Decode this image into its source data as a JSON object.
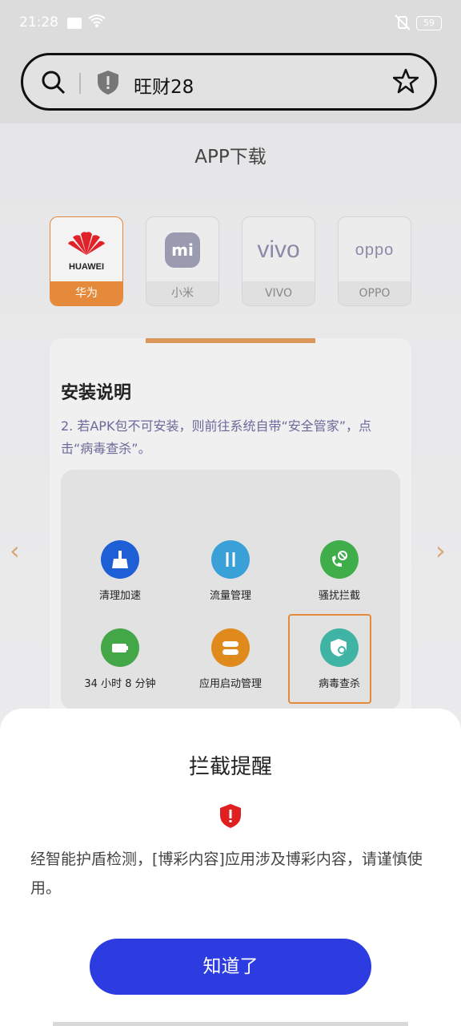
{
  "status_bar": {
    "time": "21:28",
    "battery": "59"
  },
  "search": {
    "query": "旺财28"
  },
  "page": {
    "title": "APP下载"
  },
  "brands": [
    {
      "label": "华为",
      "logo_text": "HUAWEI",
      "active": true
    },
    {
      "label": "小米",
      "logo_text": "mi",
      "active": false
    },
    {
      "label": "VIVO",
      "logo_text": "vivo",
      "active": false
    },
    {
      "label": "OPPO",
      "logo_text": "oppo",
      "active": false
    }
  ],
  "instructions": {
    "title": "安装说明",
    "text": "2. 若APK包不可安装，则前往系统自带“安全管家”，点击“病毒查杀”。",
    "apps": [
      {
        "label": "清理加速",
        "icon": "broom-icon",
        "color": "#1f5fd6"
      },
      {
        "label": "流量管理",
        "icon": "traffic-icon",
        "color": "#3aa0d8"
      },
      {
        "label": "骚扰拦截",
        "icon": "phone-block-icon",
        "color": "#3fae4a"
      },
      {
        "label": "34 小时 8 分钟",
        "icon": "battery-icon",
        "color": "#43a747"
      },
      {
        "label": "应用启动管理",
        "icon": "toggle-icon",
        "color": "#e08a1e"
      },
      {
        "label": "病毒查杀",
        "icon": "virus-scan-icon",
        "color": "#3fb3a4"
      }
    ]
  },
  "dialog": {
    "title": "拦截提醒",
    "message": "经智能护盾检测，[博彩内容]应用涉及博彩内容，请谨慎使用。",
    "button": "知道了"
  },
  "colors": {
    "accent": "#2c3ce0",
    "brand_active": "#e58a3a",
    "warning": "#e02020"
  }
}
